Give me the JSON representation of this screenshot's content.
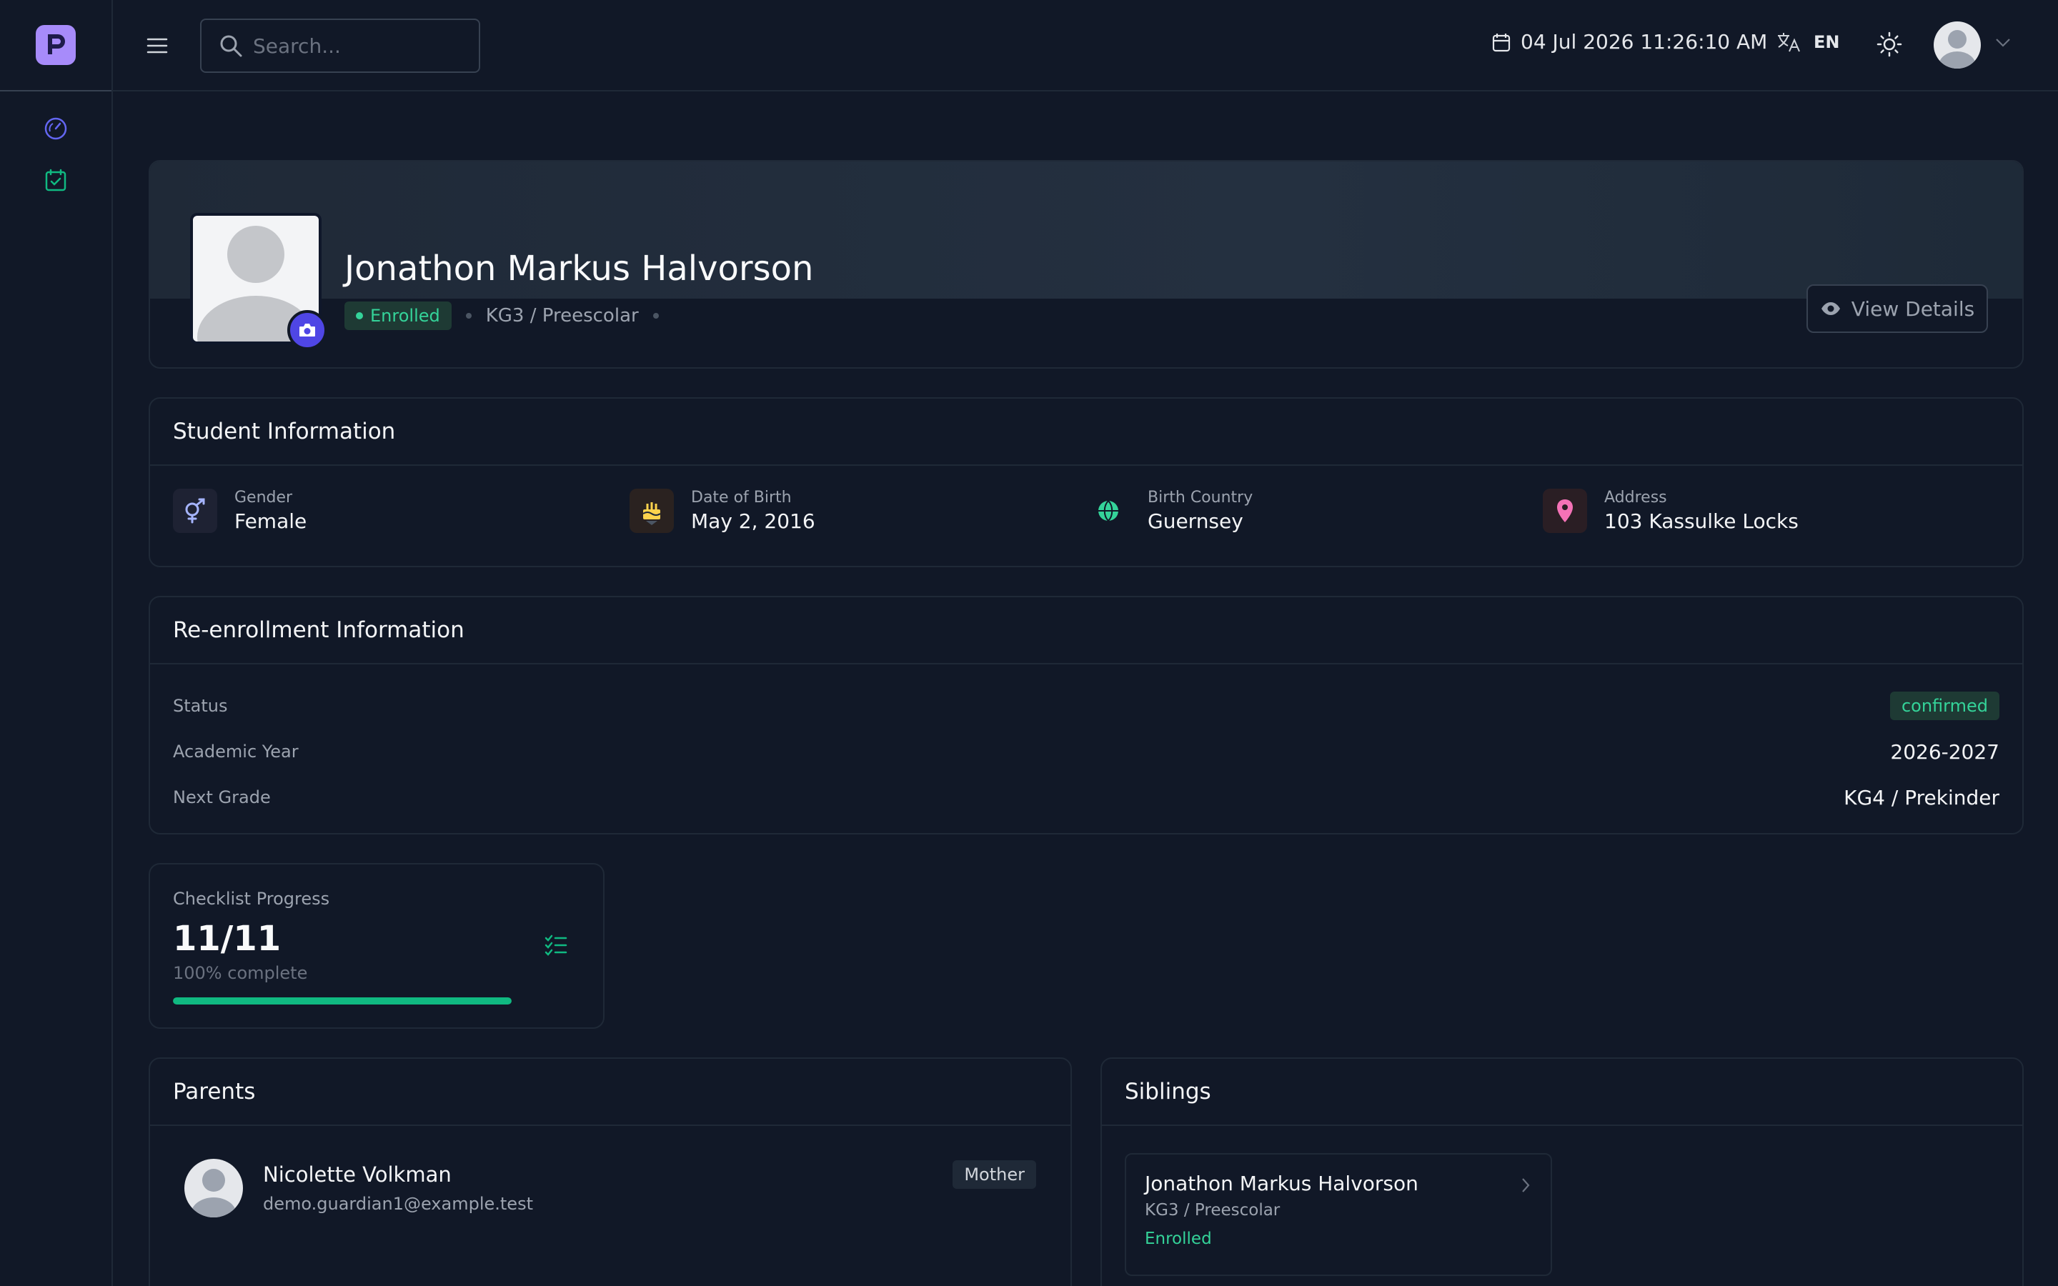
{
  "header": {
    "search_placeholder": "Search...",
    "datetime": "04 Jul 2026 11:26:10 AM",
    "language": "EN"
  },
  "profile": {
    "name": "Jonathon Markus Halvorson",
    "status": "Enrolled",
    "grade": "KG3 / Preescolar",
    "view_details_label": "View Details"
  },
  "student_info": {
    "title": "Student Information",
    "items": [
      {
        "label": "Gender",
        "value": "Female",
        "icon": "gender-icon"
      },
      {
        "label": "Date of Birth",
        "value": "May 2, 2016",
        "icon": "birthday-cake-icon"
      },
      {
        "label": "Birth Country",
        "value": "Guernsey",
        "icon": "globe-icon"
      },
      {
        "label": "Address",
        "value": "103 Kassulke Locks",
        "icon": "map-pin-icon"
      }
    ]
  },
  "reenrollment": {
    "title": "Re-enrollment Information",
    "rows": [
      {
        "label": "Status",
        "value": "confirmed"
      },
      {
        "label": "Academic Year",
        "value": "2026-2027"
      },
      {
        "label": "Next Grade",
        "value": "KG4 / Prekinder"
      }
    ]
  },
  "checklist": {
    "label": "Checklist Progress",
    "value": "11/11",
    "sub": "100% complete",
    "progress": 1.0
  },
  "parents": {
    "title": "Parents",
    "items": [
      {
        "name": "Nicolette Volkman",
        "email": "demo.guardian1@example.test",
        "relation": "Mother"
      }
    ]
  },
  "siblings": {
    "title": "Siblings",
    "items": [
      {
        "name": "Jonathon Markus Halvorson",
        "grade": "KG3 / Preescolar",
        "status": "Enrolled"
      }
    ]
  },
  "colors": {
    "accent": "#4f46e5",
    "success": "#34d399",
    "logo": "#a78bfa",
    "background": "#111827"
  }
}
